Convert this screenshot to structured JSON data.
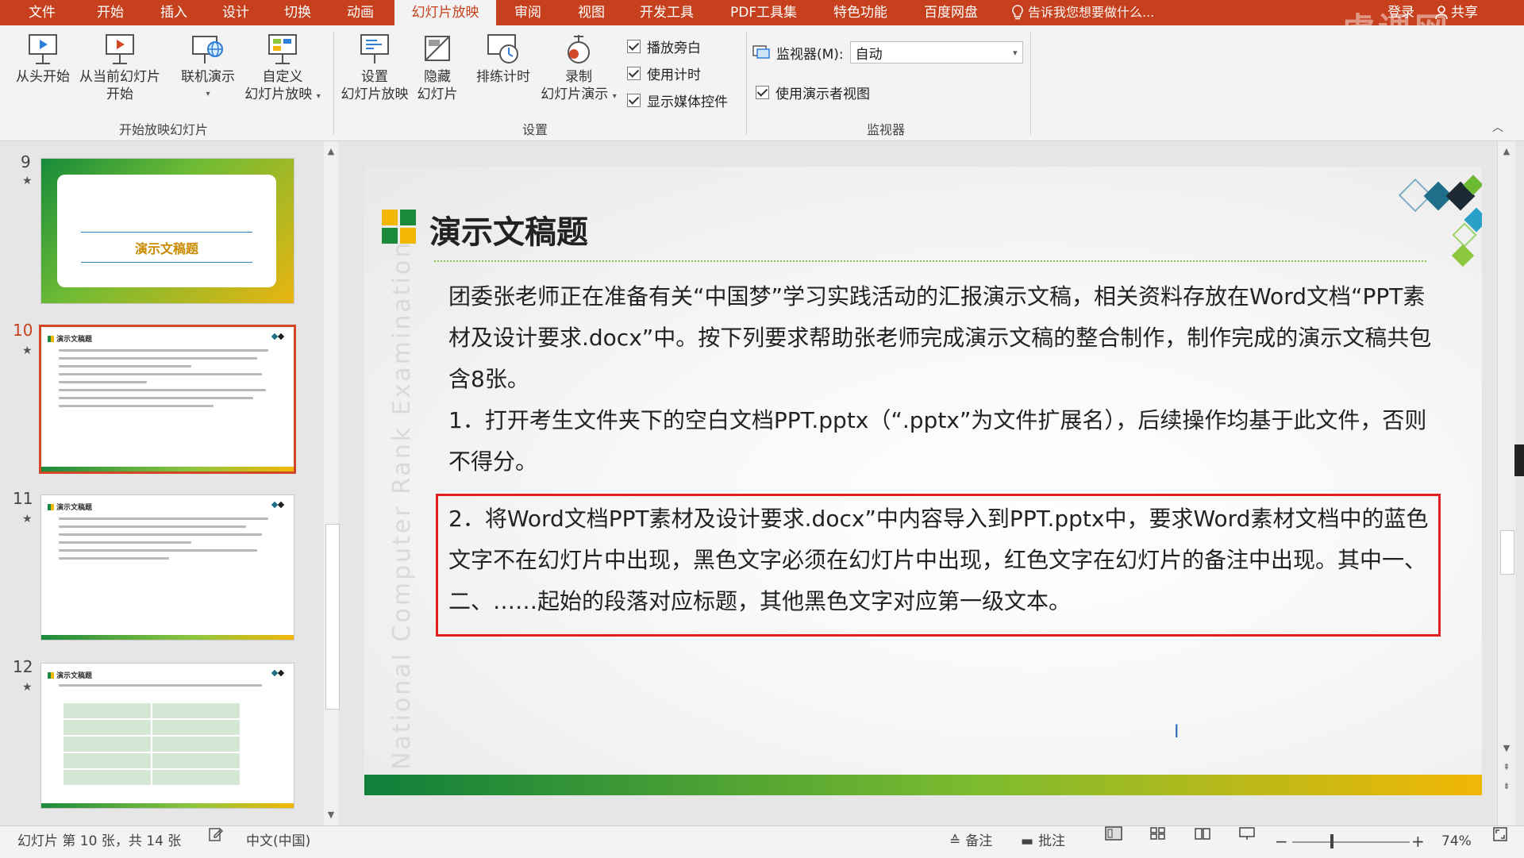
{
  "menubar": {
    "tabs": [
      "文件",
      "开始",
      "插入",
      "设计",
      "切换",
      "动画",
      "幻灯片放映",
      "审阅",
      "视图",
      "开发工具",
      "PDF工具集",
      "特色功能",
      "百度网盘"
    ],
    "active_tab": "幻灯片放映",
    "tell_me": "告诉我您想要做什么...",
    "login": "登录",
    "share": "共享",
    "watermark": "虎课网"
  },
  "ribbon": {
    "start_group": {
      "from_start": "从头开始",
      "from_current_1": "从当前幻灯片",
      "from_current_2": "开始",
      "online_present": "联机演示",
      "custom_1": "自定义",
      "custom_2": "幻灯片放映",
      "label": "开始放映幻灯片"
    },
    "setup_group": {
      "setup_1": "设置",
      "setup_2": "幻灯片放映",
      "hide_1": "隐藏",
      "hide_2": "幻灯片",
      "rehearse": "排练计时",
      "record_1": "录制",
      "record_2": "幻灯片演示",
      "play_narrations": "播放旁白",
      "use_timings": "使用计时",
      "show_media_controls": "显示媒体控件",
      "label": "设置"
    },
    "monitor_group": {
      "monitor_label": "监视器(M):",
      "monitor_value": "自动",
      "presenter_view": "使用演示者视图",
      "label": "监视器"
    }
  },
  "thumbnails": [
    {
      "number": "9",
      "star": "★",
      "title": "演示文稿题"
    },
    {
      "number": "10",
      "star": "★",
      "title": "演示文稿题"
    },
    {
      "number": "11",
      "star": "★",
      "title": "演示文稿题"
    },
    {
      "number": "12",
      "star": "★",
      "title": "演示文稿题"
    }
  ],
  "slide": {
    "title": "演示文稿题",
    "watermark": "National Computer Rank Examination",
    "para1": "团委张老师正在准备有关“中国梦”学习实践活动的汇报演示文稿，相关资料存放在Word文档“PPT素材及设计要求.docx”中。按下列要求帮助张老师完成演示文稿的整合制作，制作完成的演示文稿共包含8张。",
    "para2": "1．打开考生文件夹下的空白文档PPT.pptx（“.pptx”为文件扩展名），后续操作均基于此文件，否则不得分。",
    "para3": "2．将Word文档PPT素材及设计要求.docx”中内容导入到PPT.pptx中，要求Word素材文档中的蓝色文字不在幻灯片中出现，黑色文字必须在幻灯片中出现，红色文字在幻灯片的备注中出现。其中一、二、……起始的段落对应标题，其他黑色文字对应第一级文本。"
  },
  "status": {
    "slide_info": "幻灯片 第 10 张，共 14 张",
    "language": "中文(中国)",
    "notes": "备注",
    "comments": "批注",
    "zoom": "74%",
    "zoom_minus": "−",
    "zoom_plus": "+"
  },
  "colors": {
    "accent": "#c6401d",
    "selection": "#d24726",
    "highlight_box": "#e02020",
    "green": "#1c8a3c",
    "yellow": "#f2b705"
  }
}
